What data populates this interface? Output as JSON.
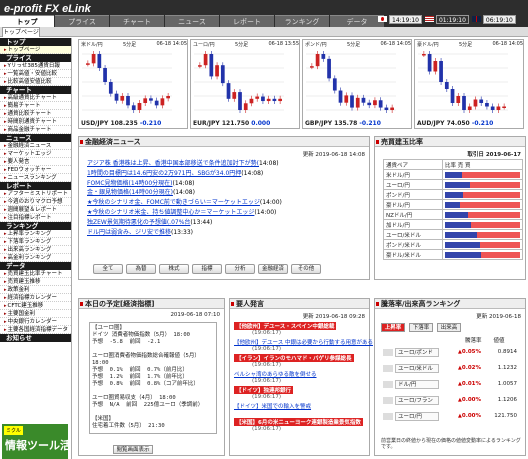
{
  "header": {
    "logo_a": "e-profit FX",
    "logo_b": "eLink",
    "tabs": [
      "トップ",
      "プライス",
      "チャート",
      "ニュース",
      "レポート",
      "ランキング",
      "データ"
    ],
    "subtab": "トップページ",
    "clocks": [
      {
        "flag": "jp",
        "time": "14:19:10"
      },
      {
        "flag": "us",
        "time": "01:19:10"
      },
      {
        "flag": "uk",
        "time": "06:19:10"
      }
    ]
  },
  "sidebar": {
    "sections": [
      {
        "title": "トップ",
        "items": [
          "トップページ"
        ]
      },
      {
        "title": "プライス",
        "items": [
          "Yリっせ385通貨日報",
          "一覧高値・安値比較",
          "比較高値安値比較"
        ]
      },
      {
        "title": "チャート",
        "items": [
          "高級通貨比チャート",
          "簡易チャート",
          "通貨比較チャート",
          "時間別通貨チャート",
          "商品金融チャート"
        ]
      },
      {
        "title": "ニュース",
        "items": [
          "金融経済ニュース",
          "マーケットエッジ",
          "要人発言",
          "FEDウォッチャー",
          "ニュースランキング"
        ]
      },
      {
        "title": "レポート",
        "items": [
          "アフターミストリポート",
          "今週のおりマクロ予想",
          "週間展望＆レポート",
          "注目指標レポート"
        ]
      },
      {
        "title": "ランキング",
        "items": [
          "上昇率ランキング",
          "下落率ランキング",
          "出来高ランキング",
          "高金利ランキング"
        ]
      },
      {
        "title": "データ",
        "items": [
          "売買建玉比率チャート",
          "売買建玉推移",
          "政策金利",
          "経済指標カレンダー",
          "CFTC建玉推移",
          "主要国金利",
          "中央銀行カレンダー",
          "主要各国経済指標データ"
        ]
      },
      {
        "title": "お知らせ",
        "items": []
      }
    ],
    "banner_tag": "ミクル",
    "banner_text": "情報ツール活用術"
  },
  "charts": [
    {
      "title": "米ドル/円",
      "period": "5分足",
      "date": "06-18 14:05",
      "pair": "USD/JPY",
      "price": "108.235",
      "change": "-0.210"
    },
    {
      "title": "ユーロ/円",
      "period": "5分足",
      "date": "06-18 13:55",
      "pair": "EUR/JPY",
      "price": "121.750",
      "change": "0.000"
    },
    {
      "title": "ポンド/円",
      "period": "5分足",
      "date": "06-18 14:05",
      "pair": "GBP/JPY",
      "price": "135.78",
      "change": "-0.210"
    },
    {
      "title": "豪ドル/円",
      "period": "5分足",
      "date": "06-18 14:05",
      "pair": "AUD/JPY",
      "price": "74.050",
      "change": "-0.210"
    }
  ],
  "chart_data": [
    {
      "type": "line",
      "series": [
        {
          "values": [
            108.38,
            108.42,
            108.36,
            108.3,
            108.25,
            108.22,
            108.24,
            108.2,
            108.18,
            108.21,
            108.23,
            108.22,
            108.2,
            108.23,
            108.24
          ]
        }
      ]
    },
    {
      "type": "line",
      "series": [
        {
          "values": [
            121.9,
            121.95,
            121.85,
            121.9,
            121.82,
            121.75,
            121.78,
            121.7,
            121.73,
            121.75,
            121.76,
            121.74,
            121.75,
            121.74,
            121.75
          ]
        }
      ]
    },
    {
      "type": "line",
      "series": [
        {
          "values": [
            135.95,
            136,
            135.98,
            135.9,
            135.85,
            135.8,
            135.83,
            135.78,
            135.82,
            135.8,
            135.79,
            135.81,
            135.78,
            135.77,
            135.78
          ]
        }
      ]
    },
    {
      "type": "line",
      "series": [
        {
          "values": [
            74.2,
            74.15,
            74.18,
            74.12,
            74.1,
            74.06,
            74.08,
            74.04,
            74.05,
            74.07,
            74.06,
            74.05,
            74.04,
            74.05,
            74.05
          ]
        }
      ]
    }
  ],
  "news": {
    "title": "金融経済ニュース",
    "updated": "更新 2019-06-18 14:08",
    "items": [
      {
        "text": "アジア株 香港株は上昇、香港中国本部移送で条件追加討下が勢(",
        "time": "14:08)"
      },
      {
        "text": "1時間の目標円は14.6円安の2万971円、SBGが34.0円押",
        "time": "(14:08)"
      },
      {
        "text": "FOMC見物価格(14時00分現在)",
        "time": "(14:08)"
      },
      {
        "text": "金・銀見物価格(14時00分現在)",
        "time": "(14:08)"
      },
      {
        "text": "★今秋のシナリオ金、FOMC前で動きづらい＝マーケットエッジ",
        "time": "(14:00)"
      },
      {
        "text": "★今秋のシナリオ米金、持ち値調整中心か＝マーケットエッジ",
        "time": "(14:00)"
      },
      {
        "text": "独ZEW景気期待悪化の予想値(.07%台",
        "time": "(13:44)"
      },
      {
        "text": "ドル円は弱含み、ジリ安で推移",
        "time": "(13:33)"
      }
    ],
    "buttons": [
      "全て",
      "為替",
      "株式",
      "指標",
      "分析",
      "金融経済",
      "その他"
    ]
  },
  "positions": {
    "title": "売買建玉比率",
    "subtitle": "取引日",
    "updated": "2019-06-17",
    "col1": "通貨ペア",
    "col2": "比率",
    "legend_sell": "売",
    "legend_buy": "買",
    "rows": [
      {
        "pair": "米ドル/円",
        "buy": 0.22
      },
      {
        "pair": "ユーロ/円",
        "buy": 0.33
      },
      {
        "pair": "ポンド/円",
        "buy": 0.24
      },
      {
        "pair": "豪ドル/円",
        "buy": 0.2
      },
      {
        "pair": "NZドル/円",
        "buy": 0.3
      },
      {
        "pair": "加ドル/円",
        "buy": 0.34
      },
      {
        "pair": "ユーロ/米ドル",
        "buy": 0.42
      },
      {
        "pair": "ポンド/米ドル",
        "buy": 0.47
      },
      {
        "pair": "豪ドル/米ドル",
        "buy": 0.48
      }
    ]
  },
  "schedule": {
    "title": "本日の予定[経済指標]",
    "updated": "2019-06-18 07:10",
    "text": "【ユーロ圏】\nドイツ 消費者物価指数（5月） 18:00\n予想  -5.8  前回  -2.1\n\nユーロ圏消費者物価指数総合確報値（5月）\n18:00\n予想  0.1%  前回  0.7%（前月比）\n予想  1.2%  前回  1.7%（前年比）\n予想  0.8%  前回  0.8%（コア前年比）\n\nユーロ圏貿易収支（4月） 18:00\n予想  N/A  前回  225億ユーロ（季調前）\n\n【米国】\n住宅着工件数（5月） 21:30",
    "button": "閲覧画面表示"
  },
  "speech": {
    "title": "要人発言",
    "updated": "更新 2019-06-18 09:28",
    "items": [
      {
        "tag": "【他欧州】デユース・スペイン中銀総裁",
        "when": "(19:06:17)"
      },
      {
        "tag": "",
        "title": "【他欧州】デユース 中銀は必要から行動する用意がある",
        "when": "(19:06:17)"
      },
      {
        "tag": "【イラン】イランのモハマド・バゲリ参謀総長",
        "when": "(19:06:17)"
      },
      {
        "tag": "",
        "title": "ペルシャ湾のあらゆる敵を倒せる",
        "when": "(19:06:17)"
      },
      {
        "tag": "【ドイツ】独連邦銀行",
        "when": "(19:06:17)"
      },
      {
        "tag": "",
        "title": "【ドイツ】米国での輸入を警戒",
        "when": ""
      },
      {
        "tag": "【米国】6月の米ニューヨーク連銀製造業景気指数",
        "when": "(19:06:17)"
      }
    ]
  },
  "ranking": {
    "title": "騰落率/出来高ランキング",
    "updated": "更新 2019-06-18",
    "tabs": [
      "上昇率",
      "下落率",
      "出来高"
    ],
    "col_change": "騰落率",
    "col_price": "値値",
    "rows": [
      {
        "pair": "ユーロ/ポンド",
        "change": "0.05%",
        "price": "0.8914"
      },
      {
        "pair": "ユーロ/米ドル",
        "change": "0.02%",
        "price": "1.1232"
      },
      {
        "pair": "ドル/円",
        "change": "0.01%",
        "price": "1.0057"
      },
      {
        "pair": "ユーロ/フラン",
        "change": "0.00%",
        "price": "1.1206"
      },
      {
        "pair": "ユーロ/円",
        "change": "0.00%",
        "price": "121.750"
      }
    ],
    "note": "前営業日の終値から現在の価格の値値変動率によるランキングです。"
  }
}
